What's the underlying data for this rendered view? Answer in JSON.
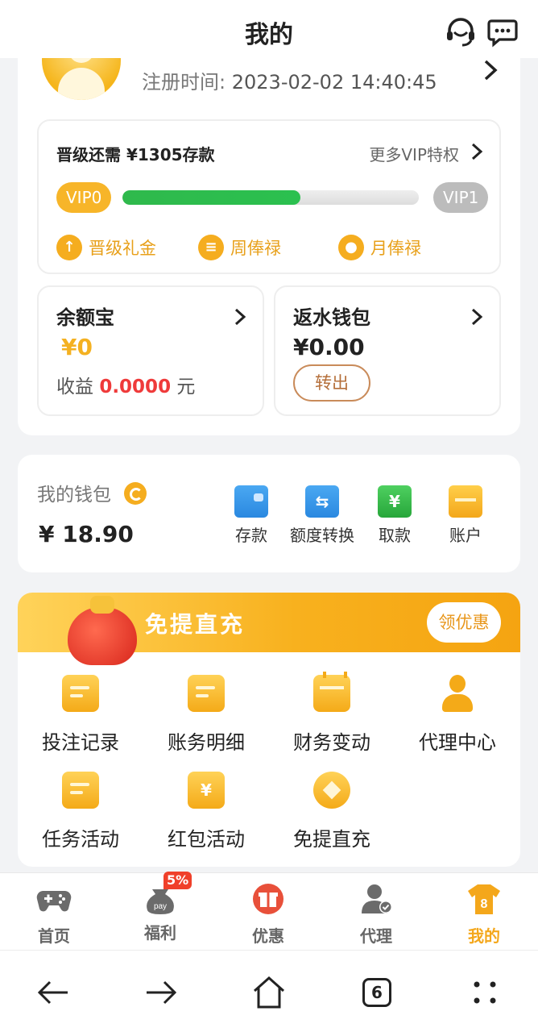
{
  "header": {
    "title": "我的",
    "support_icon": "headset-icon",
    "message_icon": "chat-bubble-icon"
  },
  "profile": {
    "registration_label": "注册时间:",
    "registration_time": "2023-02-02 14:40:45"
  },
  "vip": {
    "upgrade_need_label": "晋级还需",
    "upgrade_need_amount": "¥1305存款",
    "more_privileges": "更多VIP特权",
    "current_level": "VIP0",
    "next_level": "VIP1",
    "progress": 0.6,
    "perks": [
      {
        "icon": "upgrade-gift-icon",
        "label": "晋级礼金"
      },
      {
        "icon": "weekly-salary-icon",
        "label": "周俸禄"
      },
      {
        "icon": "monthly-salary-icon",
        "label": "月俸禄"
      }
    ]
  },
  "yuebao": {
    "title": "余额宝",
    "amount": "¥0",
    "income_label": "收益",
    "income_value": "0.0000",
    "income_unit": "元"
  },
  "rebate_wallet": {
    "title": "返水钱包",
    "amount": "¥0.00",
    "transfer_out": "转出"
  },
  "wallet": {
    "label": "我的钱包",
    "amount": "¥ 18.90",
    "actions": [
      {
        "icon": "wallet-deposit-icon",
        "label": "存款"
      },
      {
        "icon": "transfer-icon",
        "label": "额度转换"
      },
      {
        "icon": "withdraw-icon",
        "label": "取款"
      },
      {
        "icon": "bank-card-icon",
        "label": "账户"
      }
    ]
  },
  "promo_banner": {
    "title": "免提直充",
    "button": "领优惠"
  },
  "grid": [
    {
      "icon": "bet-record-icon",
      "label": "投注记录"
    },
    {
      "icon": "account-detail-icon",
      "label": "账务明细"
    },
    {
      "icon": "finance-change-icon",
      "label": "财务变动"
    },
    {
      "icon": "agent-center-icon",
      "label": "代理中心"
    },
    {
      "icon": "task-activity-icon",
      "label": "任务活动"
    },
    {
      "icon": "red-packet-icon",
      "label": "红包活动"
    },
    {
      "icon": "direct-recharge-icon",
      "label": "免提直充"
    }
  ],
  "bottom_nav": [
    {
      "icon": "gamepad-icon",
      "label": "首页"
    },
    {
      "icon": "pay-bag-icon",
      "label": "福利",
      "badge": "5%"
    },
    {
      "icon": "gift-box-icon",
      "label": "优惠"
    },
    {
      "icon": "agent-icon",
      "label": "代理"
    },
    {
      "icon": "jersey-icon",
      "label": "我的",
      "jersey_number": "8",
      "active": true
    }
  ],
  "system_nav": {
    "tabs_count": "6"
  },
  "colors": {
    "accent": "#f4a71b",
    "progress_green": "#2fb94c",
    "income_red": "#ef3a3a",
    "page_bg": "#f2f3f5"
  }
}
